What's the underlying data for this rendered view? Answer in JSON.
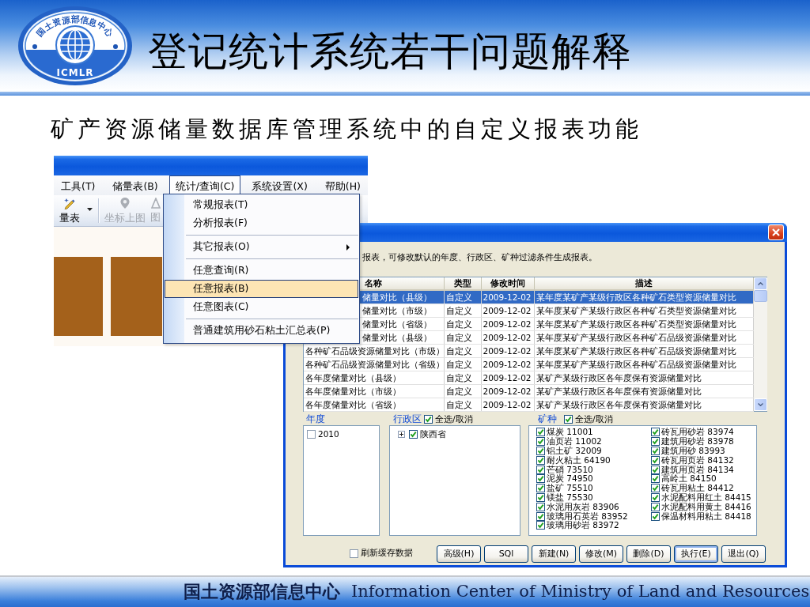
{
  "header": {
    "logo": {
      "arc_text": "国土资源部信息中心",
      "abbr": "ICMLR"
    },
    "title": "登记统计系统若干问题解释"
  },
  "subtitle": "矿产资源储量数据库管理系统中的自定义报表功能",
  "app_window": {
    "menubar": [
      {
        "label": "工具(T)",
        "selected": false
      },
      {
        "label": "储量表(B)",
        "selected": false
      },
      {
        "label": "统计/查询(C)",
        "selected": true
      },
      {
        "label": "系统设置(X)",
        "selected": false
      },
      {
        "label": "帮助(H)",
        "selected": false
      }
    ],
    "toolbar": [
      {
        "kind": "button",
        "label": "量表",
        "disabled": false,
        "dropdown": true
      },
      {
        "kind": "separator"
      },
      {
        "kind": "button",
        "label": "坐标上图",
        "disabled": true,
        "dropdown": false
      },
      {
        "kind": "button",
        "label": "图",
        "disabled": true,
        "dropdown": false
      }
    ],
    "menu": [
      {
        "kind": "item",
        "label": "常规报表(T)",
        "selected": false,
        "submenu": false
      },
      {
        "kind": "item",
        "label": "分析报表(F)",
        "selected": false,
        "submenu": false
      },
      {
        "kind": "separator"
      },
      {
        "kind": "item",
        "label": "其它报表(O)",
        "selected": false,
        "submenu": true
      },
      {
        "kind": "separator"
      },
      {
        "kind": "item",
        "label": "任意查询(R)",
        "selected": false,
        "submenu": false
      },
      {
        "kind": "item",
        "label": "任意报表(B)",
        "selected": true,
        "submenu": false
      },
      {
        "kind": "item",
        "label": "任意图表(C)",
        "selected": false,
        "submenu": false
      },
      {
        "kind": "separator"
      },
      {
        "kind": "item",
        "label": "普通建筑用砂石粘土汇总表(P)",
        "selected": false,
        "submenu": false
      }
    ]
  },
  "dialog": {
    "instruction": "报表，可修改默认的年度、行政区、矿种过滤条件生成报表。",
    "table": {
      "columns": [
        "名称",
        "类型",
        "修改时间",
        "描述"
      ],
      "rows": [
        {
          "cells": [
            "储量对比（县级）",
            "自定义",
            "2009-12-02",
            "某年度某矿产某级行政区各种矿石类型资源储量对比"
          ],
          "selected": true
        },
        {
          "cells": [
            "储量对比（市级）",
            "自定义",
            "2009-12-02",
            "某年度某矿产某级行政区各种矿石类型资源储量对比"
          ],
          "selected": false
        },
        {
          "cells": [
            "储量对比（省级）",
            "自定义",
            "2009-12-02",
            "某年度某矿产某级行政区各种矿石类型资源储量对比"
          ],
          "selected": false
        },
        {
          "cells": [
            "储量对比（县级）",
            "自定义",
            "2009-12-02",
            "某年度某矿产某级行政区各种矿石品级资源储量对比"
          ],
          "selected": false
        },
        {
          "cells": [
            "各种矿石品级资源储量对比（市级）",
            "自定义",
            "2009-12-02",
            "某年度某矿产某级行政区各种矿石品级资源储量对比"
          ],
          "selected": false
        },
        {
          "cells": [
            "各种矿石品级资源储量对比（省级）",
            "自定义",
            "2009-12-02",
            "某年度某矿产某级行政区各种矿石品级资源储量对比"
          ],
          "selected": false
        },
        {
          "cells": [
            "各年度储量对比（县级）",
            "自定义",
            "2009-12-02",
            "某矿产某级行政区各年度保有资源储量对比"
          ],
          "selected": false
        },
        {
          "cells": [
            "各年度储量对比（市级）",
            "自定义",
            "2009-12-02",
            "某矿产某级行政区各年度保有资源储量对比"
          ],
          "selected": false
        },
        {
          "cells": [
            "各年度储量对比（省级）",
            "自定义",
            "2009-12-02",
            "某矿产某级行政区各年度保有资源储量对比"
          ],
          "selected": false
        }
      ]
    },
    "year": {
      "label": "年度",
      "items": [
        {
          "label": "2010",
          "checked": false
        }
      ]
    },
    "region": {
      "label": "行政区",
      "select_all": {
        "label": "全选/取消",
        "checked": true
      },
      "tree": [
        {
          "label": "陕西省",
          "checked": true,
          "expanded": false
        }
      ]
    },
    "minerals": {
      "label": "矿种",
      "select_all": {
        "label": "全选/取消",
        "checked": true
      },
      "items": [
        {
          "label": "煤炭 11001",
          "checked": true
        },
        {
          "label": "油页岩 11002",
          "checked": true
        },
        {
          "label": "铝土矿 32009",
          "checked": true
        },
        {
          "label": "耐火粘土 64190",
          "checked": true
        },
        {
          "label": "芒硝 73510",
          "checked": true
        },
        {
          "label": "泥炭 74950",
          "checked": true
        },
        {
          "label": "盐矿 75510",
          "checked": true
        },
        {
          "label": "镁盐 75530",
          "checked": true
        },
        {
          "label": "水泥用灰岩 83906",
          "checked": true
        },
        {
          "label": "玻璃用石英岩 83952",
          "checked": true
        },
        {
          "label": "玻璃用砂岩 83972",
          "checked": true
        },
        {
          "label": "砖瓦用砂岩 83974",
          "checked": true
        },
        {
          "label": "建筑用砂岩 83978",
          "checked": true
        },
        {
          "label": "建筑用砂 83993",
          "checked": true
        },
        {
          "label": "砖瓦用页岩 84132",
          "checked": true
        },
        {
          "label": "建筑用页岩 84134",
          "checked": true
        },
        {
          "label": "高岭土 84150",
          "checked": true
        },
        {
          "label": "砖瓦用粘土 84412",
          "checked": true
        },
        {
          "label": "水泥配料用红土 84415",
          "checked": true
        },
        {
          "label": "水泥配料用黄土 84416",
          "checked": true
        },
        {
          "label": "保温材料用粘土 84418",
          "checked": true
        }
      ]
    },
    "refresh": {
      "label": "刷新缓存数据",
      "checked": false
    },
    "buttons": [
      {
        "label": "高级(H)",
        "default": false
      },
      {
        "label": "SQl",
        "default": false
      },
      {
        "label": "新建(N)",
        "default": false
      },
      {
        "label": "修改(M)",
        "default": false
      },
      {
        "label": "删除(D)",
        "default": false
      },
      {
        "label": "执行(E)",
        "default": true
      },
      {
        "label": "退出(Q)",
        "default": false
      }
    ]
  },
  "footer": {
    "org_cn": "国土资源部信息中心",
    "org_en": "Information Center of Ministry of Land and Resources"
  }
}
